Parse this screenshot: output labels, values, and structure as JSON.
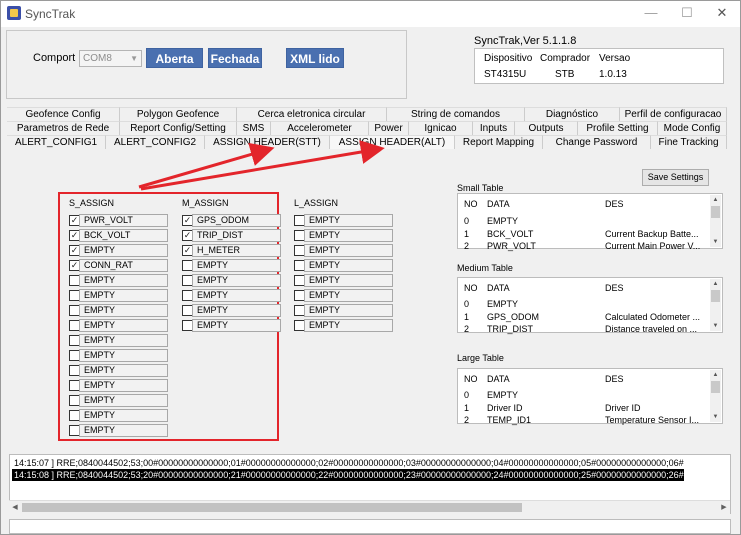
{
  "app": {
    "title": "SyncTrak",
    "version_label": "SyncTrak,Ver 5.1.1.8"
  },
  "window_controls": {
    "minimize": "—",
    "maximize": "☐",
    "close": "✕"
  },
  "connection": {
    "comport_label": "Comport :",
    "comport_value": "COM8",
    "open_label": "Aberta",
    "close_label": "Fechada",
    "xml_label": "XML lido"
  },
  "device_info": {
    "headers": [
      "Dispositivo",
      "Comprador",
      "Versao"
    ],
    "values": [
      "ST4315U",
      "STB",
      "1.0.13"
    ]
  },
  "tabs": {
    "row1": [
      "Geofence Config",
      "Polygon Geofence",
      "Cerca eletronica circular",
      "String de comandos",
      "Diagnóstico",
      "Perfil de configuracao"
    ],
    "row2": [
      "Parametros de Rede",
      "Report Config/Setting",
      "SMS",
      "Accelerometer",
      "Power",
      "Ignicao",
      "Inputs",
      "Outputs",
      "Profile Setting",
      "Mode Config"
    ],
    "row3": [
      "ALERT_CONFIG1",
      "ALERT_CONFIG2",
      "ASSIGN HEADER(STT)",
      "ASSIGN HEADER(ALT)",
      "Report Mapping",
      "Change Password",
      "Fine Tracking"
    ]
  },
  "assign": {
    "s_header": "S_ASSIGN",
    "m_header": "M_ASSIGN",
    "l_header": "L_ASSIGN",
    "s_items": [
      {
        "label": "PWR_VOLT",
        "checked": true
      },
      {
        "label": "BCK_VOLT",
        "checked": true
      },
      {
        "label": "EMPTY",
        "checked": true
      },
      {
        "label": "CONN_RAT",
        "checked": true
      },
      {
        "label": "EMPTY",
        "checked": false
      },
      {
        "label": "EMPTY",
        "checked": false
      },
      {
        "label": "EMPTY",
        "checked": false
      },
      {
        "label": "EMPTY",
        "checked": false
      },
      {
        "label": "EMPTY",
        "checked": false
      },
      {
        "label": "EMPTY",
        "checked": false
      },
      {
        "label": "EMPTY",
        "checked": false
      },
      {
        "label": "EMPTY",
        "checked": false
      },
      {
        "label": "EMPTY",
        "checked": false
      },
      {
        "label": "EMPTY",
        "checked": false
      },
      {
        "label": "EMPTY",
        "checked": false
      }
    ],
    "m_items": [
      {
        "label": "GPS_ODOM",
        "checked": true
      },
      {
        "label": "TRIP_DIST",
        "checked": true
      },
      {
        "label": "H_METER",
        "checked": true
      },
      {
        "label": "EMPTY",
        "checked": false
      },
      {
        "label": "EMPTY",
        "checked": false
      },
      {
        "label": "EMPTY",
        "checked": false
      },
      {
        "label": "EMPTY",
        "checked": false
      },
      {
        "label": "EMPTY",
        "checked": false
      }
    ],
    "l_items": [
      {
        "label": "EMPTY",
        "checked": false
      },
      {
        "label": "EMPTY",
        "checked": false
      },
      {
        "label": "EMPTY",
        "checked": false
      },
      {
        "label": "EMPTY",
        "checked": false
      },
      {
        "label": "EMPTY",
        "checked": false
      },
      {
        "label": "EMPTY",
        "checked": false
      },
      {
        "label": "EMPTY",
        "checked": false
      },
      {
        "label": "EMPTY",
        "checked": false
      }
    ]
  },
  "save_settings_label": "Save Settings",
  "tables": {
    "small": {
      "title": "Small Table",
      "headers": [
        "NO",
        "DATA",
        "DES"
      ],
      "rows": [
        [
          "0",
          "EMPTY",
          ""
        ],
        [
          "1",
          "BCK_VOLT",
          "Current Backup Batte..."
        ],
        [
          "2",
          "PWR_VOLT",
          "Current Main Power V..."
        ]
      ]
    },
    "medium": {
      "title": "Medium Table",
      "headers": [
        "NO",
        "DATA",
        "DES"
      ],
      "rows": [
        [
          "0",
          "EMPTY",
          ""
        ],
        [
          "1",
          "GPS_ODOM",
          "Calculated Odometer ..."
        ],
        [
          "2",
          "TRIP_DIST",
          "Distance traveled on ..."
        ]
      ]
    },
    "large": {
      "title": "Large Table",
      "headers": [
        "NO",
        "DATA",
        "DES"
      ],
      "rows": [
        [
          "0",
          "EMPTY",
          ""
        ],
        [
          "1",
          "Driver ID",
          "Driver ID"
        ],
        [
          "2",
          "TEMP_ID1",
          "Temperature Sensor I..."
        ]
      ]
    }
  },
  "log": {
    "lines": [
      "14:15:07 ] RRE;0840044502;53;00#00000000000000;01#00000000000000;02#00000000000000;03#00000000000000;04#00000000000000;05#00000000000000;06#",
      "14:15:08 ] RRE;0840044502;53;20#00000000000000;21#00000000000000;22#00000000000000;23#00000000000000;24#00000000000000;25#00000000000000;26#"
    ]
  },
  "colors": {
    "accent_button": "#4a70b0",
    "highlight_box": "#e3252b"
  }
}
